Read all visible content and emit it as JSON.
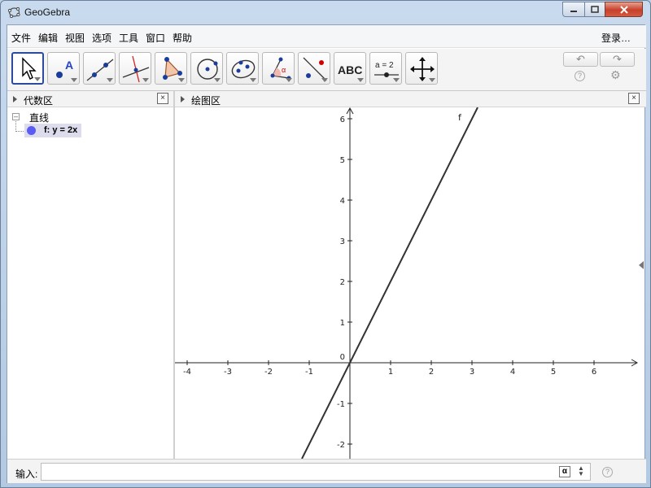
{
  "window": {
    "title": "GeoGebra"
  },
  "menu": {
    "items": [
      "文件",
      "编辑",
      "视图",
      "选项",
      "工具",
      "窗口",
      "帮助"
    ],
    "login": "登录…"
  },
  "toolbar": {
    "tools": [
      {
        "name": "move-tool",
        "selected": true
      },
      {
        "name": "point-tool",
        "label": "A"
      },
      {
        "name": "line-tool"
      },
      {
        "name": "perpendicular-line-tool"
      },
      {
        "name": "polygon-tool"
      },
      {
        "name": "circle-tool"
      },
      {
        "name": "ellipse-tool"
      },
      {
        "name": "angle-tool",
        "label": "α"
      },
      {
        "name": "reflect-tool"
      },
      {
        "name": "text-tool",
        "label": "ABC"
      },
      {
        "name": "slider-tool",
        "label": "a = 2"
      },
      {
        "name": "move-graphics-view-tool"
      }
    ],
    "undo_icon": "↶",
    "redo_icon": "↷",
    "help_icon": "?",
    "settings_icon": "⚙"
  },
  "algebra": {
    "title": "代数区",
    "group": "直线",
    "objects": [
      {
        "label": "f: y = 2x",
        "color": "#5a5cf2"
      }
    ]
  },
  "graphics": {
    "title": "绘图区",
    "function_label": "f",
    "x_ticks": [
      "-4",
      "-3",
      "-2",
      "-1",
      "1",
      "2",
      "3",
      "4",
      "5",
      "6"
    ],
    "y_ticks": [
      "-2",
      "-1",
      "1",
      "2",
      "3",
      "4",
      "5",
      "6"
    ],
    "origin_label": "0",
    "line": {
      "slope": 2,
      "intercept": 0,
      "color": "#333333"
    }
  },
  "input": {
    "label": "输入:",
    "value": "",
    "alpha_label": "α",
    "help_icon": "?"
  },
  "close_label": "×"
}
